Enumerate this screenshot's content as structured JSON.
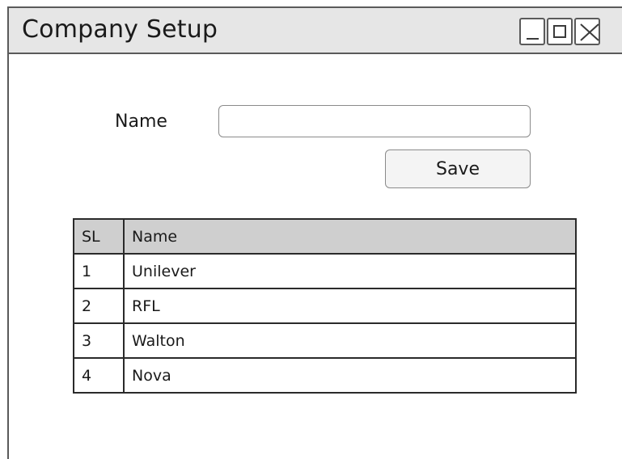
{
  "window": {
    "title": "Company Setup",
    "controls": [
      "minimize-icon",
      "maximize-icon",
      "close-icon"
    ]
  },
  "form": {
    "name_label": "Name",
    "name_value": "",
    "save_label": "Save"
  },
  "table": {
    "headers": [
      "SL",
      "Name"
    ],
    "rows": [
      [
        "1",
        "Unilever"
      ],
      [
        "2",
        "RFL"
      ],
      [
        "3",
        "Walton"
      ],
      [
        "4",
        "Nova"
      ]
    ]
  },
  "colors": {
    "titlebar": "#e6e6e6",
    "header_row": "#cfcfcf",
    "border": "#5a5a5a"
  }
}
